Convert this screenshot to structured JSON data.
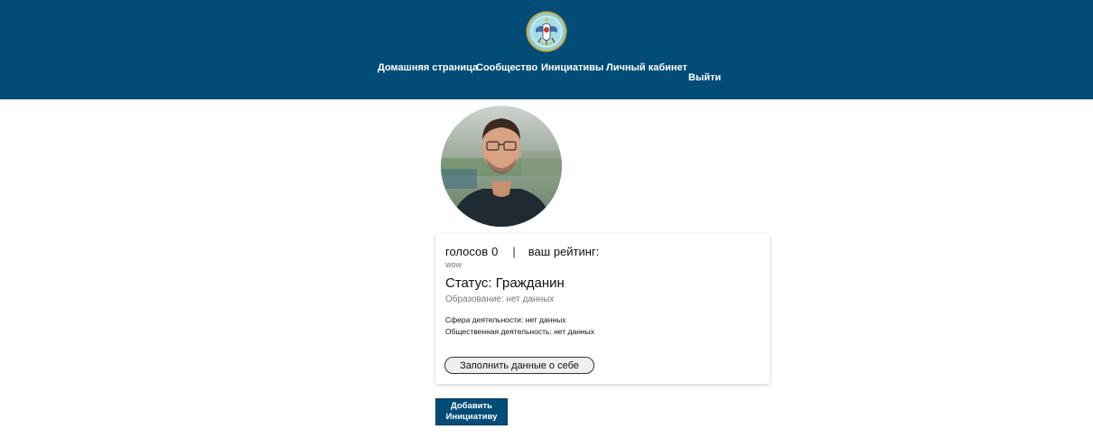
{
  "header": {
    "logo_icon": "coat-of-arms-emblem",
    "background_color": "#024c78",
    "nav": {
      "home": "Домашняя страница",
      "community": "Сообщество",
      "initiatives": "Инициативы",
      "cabinet": "Личный кабинет",
      "logout": "Выйти"
    }
  },
  "profile": {
    "avatar_icon": "user-photo",
    "votes_label": "голосов",
    "votes_count": "0",
    "separator": "|",
    "rating_label": "ваш рейтинг:",
    "rating_note": "wow",
    "status": "Статус: Гражданин",
    "education": "Образование: нет данных",
    "sphere": "Сфера деятельности: нет данных",
    "social_activity": "Общественная деятельность: нет данных",
    "fill_button": "Заполнить данные о себе"
  },
  "actions": {
    "add_initiative_line1": "Добавить",
    "add_initiative_line2": "Инициативу"
  }
}
